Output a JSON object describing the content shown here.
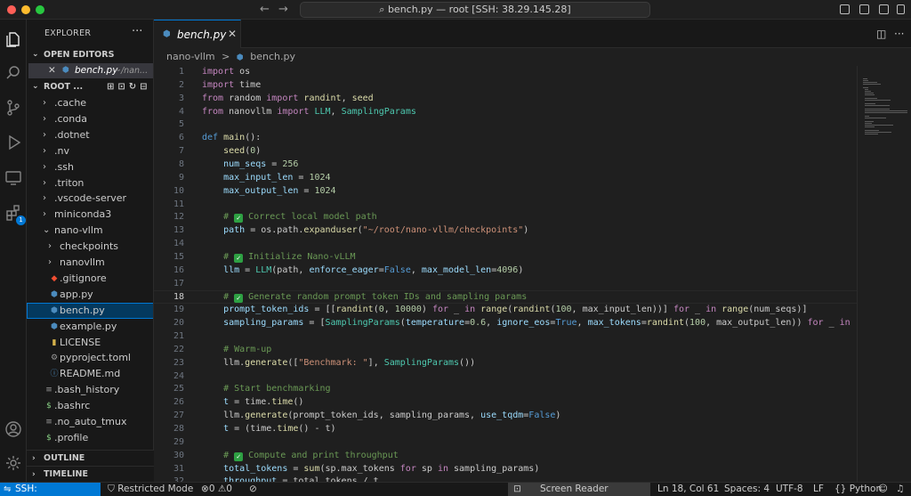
{
  "window": {
    "title": "bench.py — root [SSH: 38.29.145.28]"
  },
  "activity_bar": {
    "extensions_badge": "1"
  },
  "sidebar": {
    "title": "EXPLORER",
    "more": "···",
    "open_editors": {
      "header": "OPEN EDITORS",
      "items": [
        {
          "close": "✕",
          "name": "bench.py",
          "path": "~/nan..."
        }
      ]
    },
    "root": {
      "header": "ROOT ..."
    },
    "tree": [
      {
        "label": ".cache",
        "kind": "folder",
        "depth": 0
      },
      {
        "label": ".conda",
        "kind": "folder",
        "depth": 0
      },
      {
        "label": ".dotnet",
        "kind": "folder",
        "depth": 0
      },
      {
        "label": ".nv",
        "kind": "folder",
        "depth": 0
      },
      {
        "label": ".ssh",
        "kind": "folder",
        "depth": 0
      },
      {
        "label": ".triton",
        "kind": "folder",
        "depth": 0
      },
      {
        "label": ".vscode-server",
        "kind": "folder",
        "depth": 0
      },
      {
        "label": "miniconda3",
        "kind": "folder",
        "depth": 0
      },
      {
        "label": "nano-vllm",
        "kind": "folder-open",
        "depth": 0
      },
      {
        "label": "checkpoints",
        "kind": "folder",
        "depth": 1
      },
      {
        "label": "nanovllm",
        "kind": "folder",
        "depth": 1
      },
      {
        "label": ".gitignore",
        "kind": "git",
        "depth": 1
      },
      {
        "label": "app.py",
        "kind": "python",
        "depth": 1
      },
      {
        "label": "bench.py",
        "kind": "python",
        "depth": 1,
        "selected": true
      },
      {
        "label": "example.py",
        "kind": "python",
        "depth": 1
      },
      {
        "label": "LICENSE",
        "kind": "license",
        "depth": 1
      },
      {
        "label": "pyproject.toml",
        "kind": "toml",
        "depth": 1
      },
      {
        "label": "README.md",
        "kind": "info",
        "depth": 1
      },
      {
        "label": ".bash_history",
        "kind": "lines",
        "depth": 0
      },
      {
        "label": ".bashrc",
        "kind": "shell",
        "depth": 0
      },
      {
        "label": ".no_auto_tmux",
        "kind": "lines",
        "depth": 0
      },
      {
        "label": ".profile",
        "kind": "shell",
        "depth": 0
      }
    ],
    "outline": "OUTLINE",
    "timeline": "TIMELINE"
  },
  "editor": {
    "tab": {
      "label": "bench.py",
      "close": "✕"
    },
    "breadcrumbs": [
      "nano-vllm",
      ">",
      "bench.py"
    ],
    "current_line": 18,
    "lines": [
      {
        "n": "1",
        "html": "<span class=\"kw\">import</span> os"
      },
      {
        "n": "2",
        "html": "<span class=\"kw\">import</span> time"
      },
      {
        "n": "3",
        "html": "<span class=\"kw\">from</span> random <span class=\"kw\">import</span> <span class=\"fn\">randint</span>, <span class=\"fn\">seed</span>"
      },
      {
        "n": "4",
        "html": "<span class=\"kw\">from</span> nanovllm <span class=\"kw\">import</span> <span class=\"cls\">LLM</span>, <span class=\"cls\">SamplingParams</span>"
      },
      {
        "n": "5",
        "html": ""
      },
      {
        "n": "6",
        "html": "<span class=\"def\">def</span> <span class=\"fn\">main</span>():"
      },
      {
        "n": "7",
        "html": "    <span class=\"fn\">seed</span>(<span class=\"num\">0</span>)"
      },
      {
        "n": "8",
        "html": "    <span class=\"var\">num_seqs</span> = <span class=\"num\">256</span>"
      },
      {
        "n": "9",
        "html": "    <span class=\"var\">max_input_len</span> = <span class=\"num\">1024</span>"
      },
      {
        "n": "10",
        "html": "    <span class=\"var\">max_output_len</span> = <span class=\"num\">1024</span>"
      },
      {
        "n": "11",
        "html": ""
      },
      {
        "n": "12",
        "html": "    <span class=\"com\"># <span class=\"chk\">✓</span> Correct local model path</span>"
      },
      {
        "n": "13",
        "html": "    <span class=\"var\">path</span> = os.path.<span class=\"fn\">expanduser</span>(<span class=\"str\">\"~/root/nano-vllm/checkpoints\"</span>)"
      },
      {
        "n": "14",
        "html": ""
      },
      {
        "n": "15",
        "html": "    <span class=\"com\"># <span class=\"chk\">✓</span> Initialize Nano-vLLM</span>"
      },
      {
        "n": "16",
        "html": "    <span class=\"var\">llm</span> = <span class=\"cls\">LLM</span>(path, <span class=\"var\">enforce_eager</span>=<span class=\"bool\">False</span>, <span class=\"var\">max_model_len</span>=<span class=\"num\">4096</span>)"
      },
      {
        "n": "17",
        "html": ""
      },
      {
        "n": "18",
        "html": "    <span class=\"com\"># <span class=\"chk\">✓</span> Generate random prompt token IDs and sampling params</span>"
      },
      {
        "n": "19",
        "html": "    <span class=\"var\">prompt_token_ids</span> = [[<span class=\"fn\">randint</span>(<span class=\"num\">0</span>, <span class=\"num\">10000</span>) <span class=\"kw\">for</span> _ <span class=\"kw\">in</span> <span class=\"fn\">range</span>(<span class=\"fn\">randint</span>(<span class=\"num\">100</span>, max_input_len))] <span class=\"kw\">for</span> _ <span class=\"kw\">in</span> <span class=\"fn\">range</span>(num_seqs)]"
      },
      {
        "n": "20",
        "html": "    <span class=\"var\">sampling_params</span> = [<span class=\"cls\">SamplingParams</span>(<span class=\"var\">temperature</span>=<span class=\"num\">0.6</span>, <span class=\"var\">ignore_eos</span>=<span class=\"bool\">True</span>, <span class=\"var\">max_tokens</span>=<span class=\"fn\">randint</span>(<span class=\"num\">100</span>, max_output_len)) <span class=\"kw\">for</span> _ <span class=\"kw\">in</span> <span class=\"fn\">rang</span>"
      },
      {
        "n": "21",
        "html": ""
      },
      {
        "n": "22",
        "html": "    <span class=\"com\"># Warm-up</span>"
      },
      {
        "n": "23",
        "html": "    llm.<span class=\"fn\">generate</span>([<span class=\"str\">\"Benchmark: \"</span>], <span class=\"cls\">SamplingParams</span>())"
      },
      {
        "n": "24",
        "html": ""
      },
      {
        "n": "25",
        "html": "    <span class=\"com\"># Start benchmarking</span>"
      },
      {
        "n": "26",
        "html": "    <span class=\"var\">t</span> = time.<span class=\"fn\">time</span>()"
      },
      {
        "n": "27",
        "html": "    llm.<span class=\"fn\">generate</span>(prompt_token_ids, sampling_params, <span class=\"var\">use_tqdm</span>=<span class=\"bool\">False</span>)"
      },
      {
        "n": "28",
        "html": "    <span class=\"var\">t</span> = (time.<span class=\"fn\">time</span>() - t)"
      },
      {
        "n": "29",
        "html": ""
      },
      {
        "n": "30",
        "html": "    <span class=\"com\"># <span class=\"chk\">✓</span> Compute and print throughput</span>"
      },
      {
        "n": "31",
        "html": "    <span class=\"var\">total_tokens</span> = <span class=\"fn\">sum</span>(sp.max_tokens <span class=\"kw\">for</span> sp <span class=\"kw\">in</span> sampling_params)"
      },
      {
        "n": "32",
        "html": "    <span class=\"var\">throughput</span> = total_tokens / t"
      }
    ]
  },
  "status_bar": {
    "remote": "SSH: 38.29.145.28",
    "restricted": "Restricted Mode",
    "errors": "0",
    "warnings": "0",
    "screen_reader": "Screen Reader Optimized",
    "position": "Ln 18, Col 61",
    "spaces": "Spaces: 4",
    "encoding": "UTF-8",
    "eol": "LF",
    "language": "Python"
  },
  "colors": {
    "accent": "#0078d4",
    "background": "#1f1f1f",
    "sidebar": "#181818"
  }
}
